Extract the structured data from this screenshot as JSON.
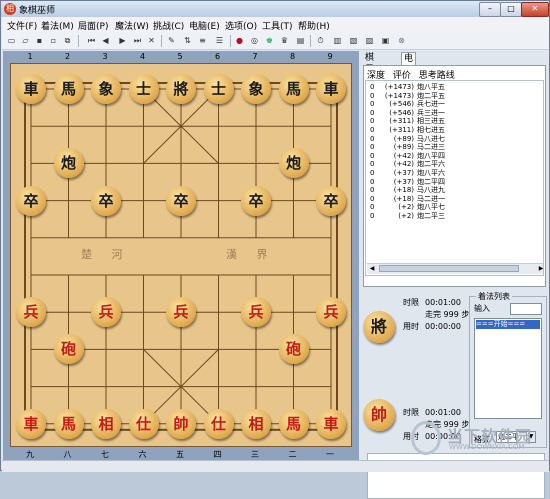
{
  "window": {
    "title": "象棋巫师",
    "app_icon": "相",
    "min": "–",
    "max": "□",
    "close": "✕"
  },
  "menu": [
    "文件(F)",
    "着法(M)",
    "局面(P)",
    "魔法(W)",
    "挑战(C)",
    "电脑(E)",
    "选项(O)",
    "工具(T)",
    "帮助(H)"
  ],
  "toolbar": [
    "new-icon",
    "open-icon",
    "save-icon",
    "saveas-icon",
    "copy-icon",
    "paste-icon",
    "first-icon",
    "prev-icon",
    "next-icon",
    "last-icon",
    "delete-icon",
    "edit-icon",
    "swap-icon",
    "record-icon",
    "palette-icon",
    "analyze-icon",
    "ai-red-icon",
    "ai-black-icon",
    "info-icon",
    "clock-icon",
    "book-icon",
    "book2-icon",
    "book3-icon",
    "monitor-icon",
    "stop-icon"
  ],
  "board": {
    "top_coords": [
      "1",
      "2",
      "3",
      "4",
      "5",
      "6",
      "7",
      "8",
      "9"
    ],
    "bottom_coords": [
      "九",
      "八",
      "七",
      "六",
      "五",
      "四",
      "三",
      "二",
      "一"
    ],
    "river_left": "楚 河",
    "river_right": "漢 界",
    "pieces": [
      {
        "name": "black-chariot-left",
        "text": "車",
        "side": "black",
        "file": 0,
        "rank": 0
      },
      {
        "name": "black-horse-left",
        "text": "馬",
        "side": "black",
        "file": 1,
        "rank": 0
      },
      {
        "name": "black-elephant-left",
        "text": "象",
        "side": "black",
        "file": 2,
        "rank": 0
      },
      {
        "name": "black-advisor-left",
        "text": "士",
        "side": "black",
        "file": 3,
        "rank": 0
      },
      {
        "name": "black-general",
        "text": "將",
        "side": "black",
        "file": 4,
        "rank": 0
      },
      {
        "name": "black-advisor-right",
        "text": "士",
        "side": "black",
        "file": 5,
        "rank": 0
      },
      {
        "name": "black-elephant-right",
        "text": "象",
        "side": "black",
        "file": 6,
        "rank": 0
      },
      {
        "name": "black-horse-right",
        "text": "馬",
        "side": "black",
        "file": 7,
        "rank": 0
      },
      {
        "name": "black-chariot-right",
        "text": "車",
        "side": "black",
        "file": 8,
        "rank": 0
      },
      {
        "name": "black-cannon-left",
        "text": "炮",
        "side": "black",
        "file": 1,
        "rank": 2
      },
      {
        "name": "black-cannon-right",
        "text": "炮",
        "side": "black",
        "file": 7,
        "rank": 2
      },
      {
        "name": "black-soldier-1",
        "text": "卒",
        "side": "black",
        "file": 0,
        "rank": 3
      },
      {
        "name": "black-soldier-2",
        "text": "卒",
        "side": "black",
        "file": 2,
        "rank": 3
      },
      {
        "name": "black-soldier-3",
        "text": "卒",
        "side": "black",
        "file": 4,
        "rank": 3
      },
      {
        "name": "black-soldier-4",
        "text": "卒",
        "side": "black",
        "file": 6,
        "rank": 3
      },
      {
        "name": "black-soldier-5",
        "text": "卒",
        "side": "black",
        "file": 8,
        "rank": 3
      },
      {
        "name": "red-soldier-1",
        "text": "兵",
        "side": "red",
        "file": 0,
        "rank": 6
      },
      {
        "name": "red-soldier-2",
        "text": "兵",
        "side": "red",
        "file": 2,
        "rank": 6
      },
      {
        "name": "red-soldier-3",
        "text": "兵",
        "side": "red",
        "file": 4,
        "rank": 6
      },
      {
        "name": "red-soldier-4",
        "text": "兵",
        "side": "red",
        "file": 6,
        "rank": 6
      },
      {
        "name": "red-soldier-5",
        "text": "兵",
        "side": "red",
        "file": 8,
        "rank": 6
      },
      {
        "name": "red-cannon-left",
        "text": "砲",
        "side": "red",
        "file": 1,
        "rank": 7
      },
      {
        "name": "red-cannon-right",
        "text": "砲",
        "side": "red",
        "file": 7,
        "rank": 7
      },
      {
        "name": "red-chariot-left",
        "text": "車",
        "side": "red",
        "file": 0,
        "rank": 9
      },
      {
        "name": "red-horse-left",
        "text": "馬",
        "side": "red",
        "file": 1,
        "rank": 9
      },
      {
        "name": "red-elephant-left",
        "text": "相",
        "side": "red",
        "file": 2,
        "rank": 9
      },
      {
        "name": "red-advisor-left",
        "text": "仕",
        "side": "red",
        "file": 3,
        "rank": 9
      },
      {
        "name": "red-general",
        "text": "帥",
        "side": "red",
        "file": 4,
        "rank": 9
      },
      {
        "name": "red-advisor-right",
        "text": "仕",
        "side": "red",
        "file": 5,
        "rank": 9
      },
      {
        "name": "red-elephant-right",
        "text": "相",
        "side": "red",
        "file": 6,
        "rank": 9
      },
      {
        "name": "red-horse-right",
        "text": "馬",
        "side": "red",
        "file": 7,
        "rank": 9
      },
      {
        "name": "red-chariot-right",
        "text": "車",
        "side": "red",
        "file": 8,
        "rank": 9
      }
    ]
  },
  "side": {
    "tabs": [
      "棋局信息",
      "电脑分析"
    ],
    "columns": [
      "深度",
      "评价",
      "思考路线"
    ],
    "analysis": [
      {
        "depth": "0",
        "score": "(+1473)",
        "line": "炮八平五"
      },
      {
        "depth": "0",
        "score": "(+1473)",
        "line": "炮二平五"
      },
      {
        "depth": "0",
        "score": "(+546)",
        "line": "兵七进一"
      },
      {
        "depth": "0",
        "score": "(+546)",
        "line": "兵三进一"
      },
      {
        "depth": "0",
        "score": "(+311)",
        "line": "相三进五"
      },
      {
        "depth": "0",
        "score": "(+311)",
        "line": "相七进五"
      },
      {
        "depth": "0",
        "score": "(+89)",
        "line": "马八进七"
      },
      {
        "depth": "0",
        "score": "(+89)",
        "line": "马二进三"
      },
      {
        "depth": "0",
        "score": "(+42)",
        "line": "炮八平四"
      },
      {
        "depth": "0",
        "score": "(+42)",
        "line": "炮二平六"
      },
      {
        "depth": "0",
        "score": "(+37)",
        "line": "炮八平六"
      },
      {
        "depth": "0",
        "score": "(+37)",
        "line": "炮二平四"
      },
      {
        "depth": "0",
        "score": "(+18)",
        "line": "马八进九"
      },
      {
        "depth": "0",
        "score": "(+18)",
        "line": "马二进一"
      },
      {
        "depth": "0",
        "score": "(+2)",
        "line": "炮八平七"
      },
      {
        "depth": "0",
        "score": "(+2)",
        "line": "炮二平三"
      }
    ],
    "black_player": {
      "piece": "將",
      "time_limit_label": "时限",
      "time_limit": "00:01:00",
      "moves_label": "走完",
      "moves": "999 步",
      "used_label": "用时",
      "used": "00:00:00"
    },
    "red_player": {
      "piece": "帥",
      "time_limit_label": "时限",
      "time_limit": "00:01:00",
      "moves_label": "走完",
      "moves": "999 步",
      "used_label": "用时",
      "used": "00:00:00"
    },
    "move_list_title": "着法列表",
    "input_label": "输入",
    "move_list_first": "===开始===",
    "format_label": "格式",
    "format_value": "炮二平"
  },
  "watermark": {
    "text": "当下软件园",
    "sub": "WWW.DOWNXIA.COM"
  }
}
